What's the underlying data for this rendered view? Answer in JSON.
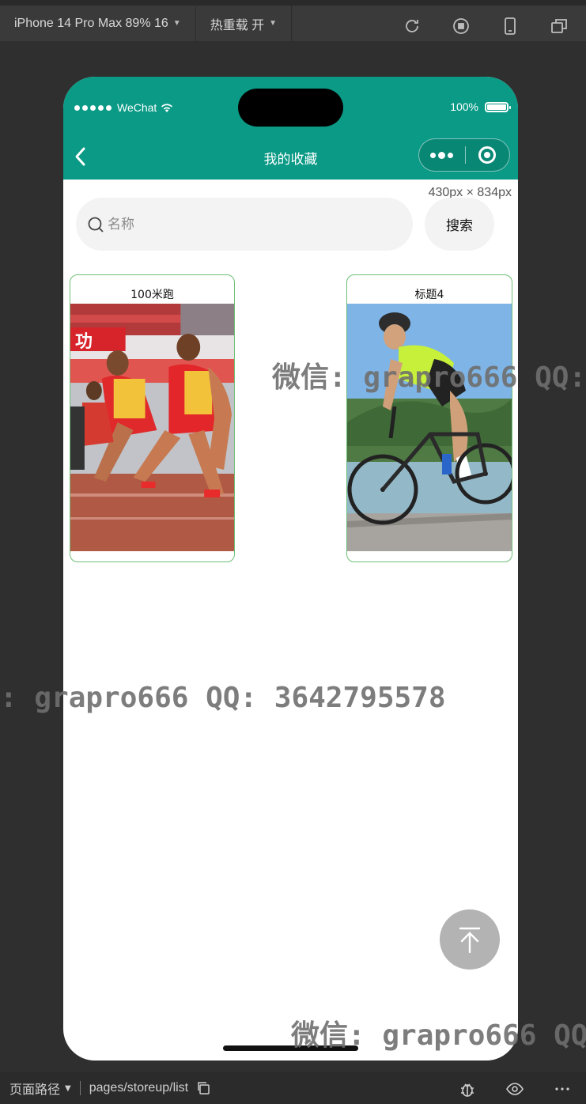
{
  "toolbar": {
    "device": "iPhone 14 Pro Max 89% 16",
    "hot_reload": "热重载 开",
    "icons": [
      "refresh-icon",
      "record-icon",
      "phone-icon",
      "window-icon"
    ]
  },
  "status": {
    "carrier": "WeChat",
    "battery": "100%"
  },
  "nav": {
    "title": "我的收藏"
  },
  "viewport_dims": "430px × 834px",
  "search": {
    "placeholder": "名称",
    "button_label": "搜索"
  },
  "cards": [
    {
      "title": "100米跑",
      "image": "sprinters-photo"
    },
    {
      "title": "标题4",
      "image": "cyclist-photo"
    }
  ],
  "watermarks": [
    "微信: grapro666 QQ:",
    ": grapro666 QQ: 3642795578",
    "微信: grapro666 QQ"
  ],
  "bottom": {
    "path_label": "页面路径",
    "path": "pages/storeup/list"
  },
  "colors": {
    "nav_bg": "#0a9a86",
    "card_border": "#6cbf76"
  }
}
